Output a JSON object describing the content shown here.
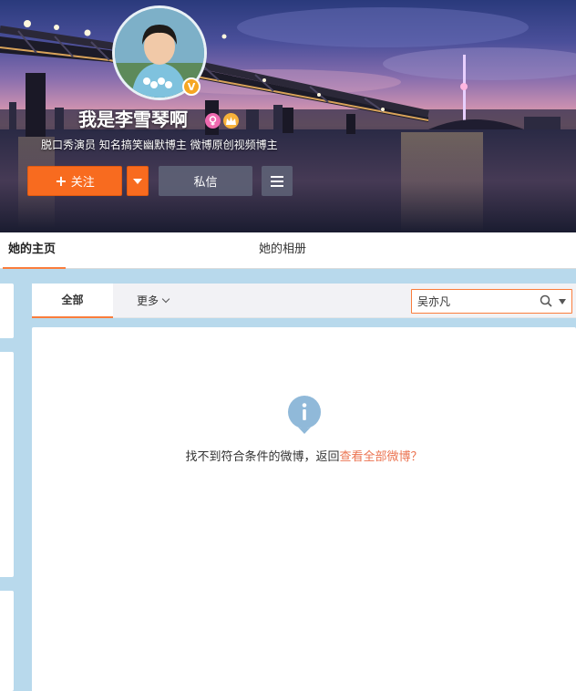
{
  "profile": {
    "name": "我是李雪琴啊",
    "bio": "脱口秀演员 知名搞笑幽默博主 微博原创视频博主",
    "verified_badge": "V"
  },
  "actions": {
    "follow_label": "关注",
    "message_label": "私信"
  },
  "tabs": {
    "home": "她的主页",
    "album": "她的相册"
  },
  "filter": {
    "all": "全部",
    "more": "更多",
    "search_value": "吴亦凡"
  },
  "empty": {
    "message": "找不到符合条件的微博，返回",
    "link": "查看全部微博？"
  },
  "colors": {
    "accent": "#fa7d3c",
    "follow": "#f86b1f",
    "link": "#eb7350",
    "info_icon": "#90b9d9",
    "page_bg": "#b8d9ec"
  }
}
